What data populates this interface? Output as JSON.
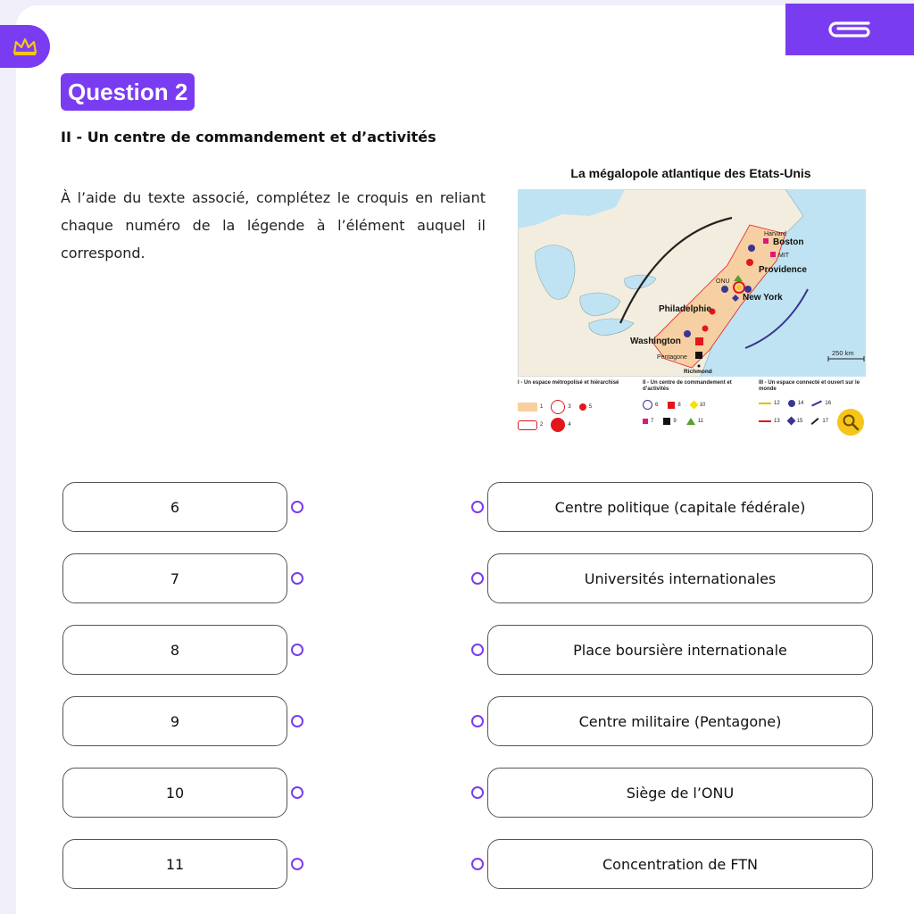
{
  "header": {
    "question_label": "Question 2",
    "logo_icon": "crown-icon",
    "top_button_icon": "paperclip-icon"
  },
  "content": {
    "subtitle": "II - Un centre de commandement et d’activités",
    "instructions": "À l’aide du texte associé, complétez le croquis en reliant chaque numéro de la légende à l’élément auquel il correspond."
  },
  "map": {
    "title": "La mégalopole atlantique des Etats-Unis",
    "labels": {
      "harvard": "Harvard",
      "boston": "Boston",
      "mit": "MIT",
      "providence": "Providence",
      "onu": "ONU",
      "new_york": "New York",
      "philadelphie": "Philadelphie",
      "washington": "Washington",
      "pentagone": "Pentagone",
      "richmond": "Richmond",
      "scale": "250 km"
    },
    "legend": {
      "section1": "I - Un espace métropolisé et hiérarchisé",
      "section2": "II - Un centre de commandement et d’activités",
      "section3": "III - Un espace connecté et ouvert sur le monde",
      "n1": "1",
      "n2": "2",
      "n3": "3",
      "n4": "4",
      "n5": "5",
      "n6": "6",
      "n7": "7",
      "n8": "8",
      "n9": "9",
      "n10": "10",
      "n11": "11",
      "n12": "12",
      "n13": "13",
      "n14": "14",
      "n15": "15",
      "n16": "16",
      "n17": "17"
    },
    "zoom_icon": "magnifier-icon"
  },
  "matching": {
    "left": [
      "6",
      "7",
      "8",
      "9",
      "10",
      "11"
    ],
    "right": [
      "Centre politique (capitale fédérale)",
      "Universités internationales",
      "Place boursière internationale",
      "Centre militaire (Pentagone)",
      "Siège de l’ONU",
      "Concentration de FTN"
    ]
  },
  "colors": {
    "accent": "#7a3cf0",
    "water": "#bfe3f2",
    "land": "#f3ede0",
    "metro": "#f7cfa0",
    "red": "#e3161b",
    "magenta": "#e0157e",
    "navy": "#3a3592"
  }
}
